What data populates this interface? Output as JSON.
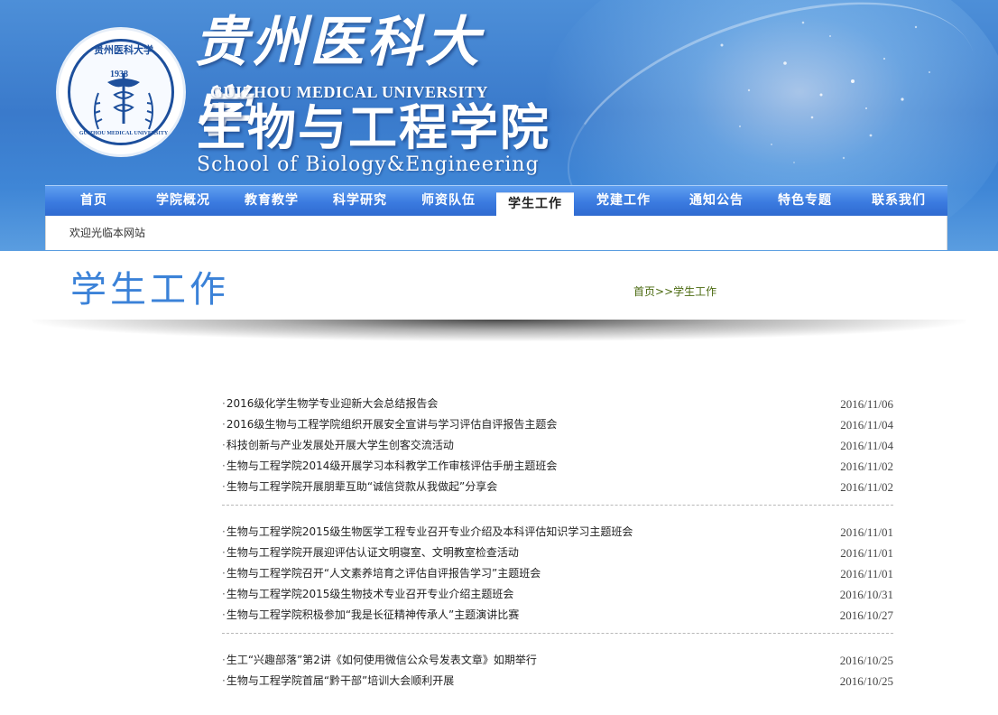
{
  "header": {
    "university_cn": "贵州医科大学",
    "university_en": "GUIZHOU MEDICAL UNIVERSITY",
    "school_cn": "生物与工程学院",
    "school_en": "School of Biology&Engineering",
    "seal": {
      "year": "1938",
      "text_cn": "贵州医科大学",
      "text_en": "GUIZHOU MEDICAL UNIVERSITY"
    }
  },
  "nav": {
    "items": [
      "首页",
      "学院概况",
      "教育教学",
      "科学研究",
      "师资队伍",
      "学生工作",
      "党建工作",
      "通知公告",
      "特色专题",
      "联系我们"
    ],
    "active_index": 5
  },
  "welcome": "欢迎光临本网站",
  "page": {
    "title": "学生工作",
    "breadcrumb": {
      "home": "首页",
      "separator": ">>",
      "current": "学生工作"
    }
  },
  "news_groups": [
    [
      {
        "title": "2016级化学生物学专业迎新大会总结报告会",
        "date": "2016/11/06"
      },
      {
        "title": "2016级生物与工程学院组织开展安全宣讲与学习评估自评报告主题会",
        "date": "2016/11/04"
      },
      {
        "title": "科技创新与产业发展处开展大学生创客交流活动",
        "date": "2016/11/04"
      },
      {
        "title": "生物与工程学院2014级开展学习本科教学工作审核评估手册主题班会",
        "date": "2016/11/02"
      },
      {
        "title": "生物与工程学院开展朋辈互助“诚信贷款从我做起”分享会",
        "date": "2016/11/02"
      }
    ],
    [
      {
        "title": "生物与工程学院2015级生物医学工程专业召开专业介绍及本科评估知识学习主题班会",
        "date": "2016/11/01"
      },
      {
        "title": "生物与工程学院开展迎评估认证文明寝室、文明教室检查活动",
        "date": "2016/11/01"
      },
      {
        "title": "生物与工程学院召开“人文素养培育之评估自评报告学习”主题班会",
        "date": "2016/11/01"
      },
      {
        "title": "生物与工程学院2015级生物技术专业召开专业介绍主题班会",
        "date": "2016/10/31"
      },
      {
        "title": "生物与工程学院积极参加“我是长征精神传承人”主题演讲比赛",
        "date": "2016/10/27"
      }
    ],
    [
      {
        "title": "生工“兴趣部落”第2讲《如何使用微信公众号发表文章》如期举行",
        "date": "2016/10/25"
      },
      {
        "title": "生物与工程学院首届“黔干部”培训大会顺利开展",
        "date": "2016/10/25"
      }
    ]
  ]
}
